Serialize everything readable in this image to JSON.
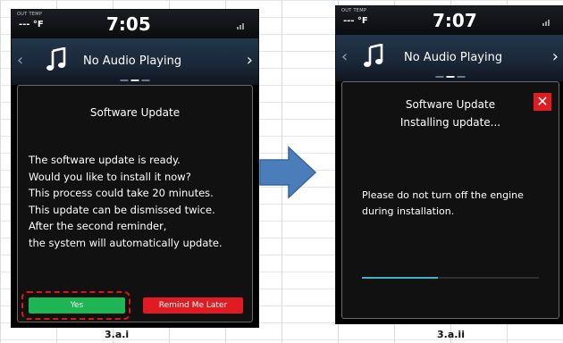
{
  "screens": [
    {
      "status": {
        "out_temp_label": "OUT TEMP",
        "out_temp": "--- °F",
        "time": "7:05"
      },
      "audio": {
        "text": "No Audio Playing",
        "icon": "music-note-icon"
      },
      "dialog": {
        "title": "Software Update",
        "message_lines": [
          "The software update is ready.",
          "Would you like to install it now?",
          "This process could take 20 minutes.",
          "This update can be dismissed twice.",
          "After the second reminder,",
          "the system will automatically update."
        ],
        "yes_label": "Yes",
        "remind_label": "Remind Me Later"
      },
      "caption": "3.a.i"
    },
    {
      "status": {
        "out_temp_label": "OUT TEMP",
        "out_temp": "--- °F",
        "time": "7:07"
      },
      "audio": {
        "text": "No Audio Playing",
        "icon": "music-note-icon"
      },
      "dialog": {
        "title": "Software Update",
        "subtitle": "Installing update...",
        "close_label": "✕",
        "message_lines": [
          "Please do not turn off the engine",
          "during installation."
        ],
        "progress": 0.43
      },
      "caption": "3.a.ii"
    }
  ],
  "colors": {
    "yes": "#1fb454",
    "remind": "#e01b22",
    "close": "#e01b22",
    "progress": "#3fb3c8",
    "arrow": "#4a7ebb",
    "highlight": "#e0131b"
  }
}
